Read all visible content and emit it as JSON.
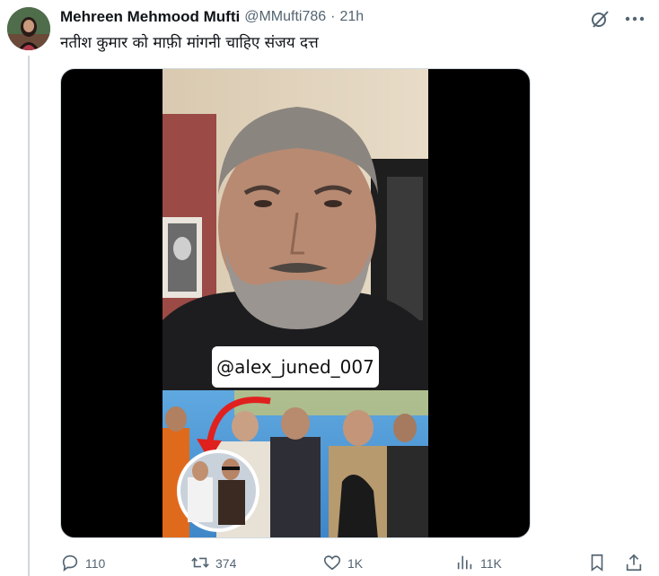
{
  "tweet": {
    "author_name": "Mehreen Mehmood Mufti",
    "handle": "@MMufti786",
    "separator": "·",
    "time": "21h",
    "text": "नतीश कुमार को माफ़ी मांगनी चाहिए संजय दत्त"
  },
  "media": {
    "overlay_tag": "@alex_juned_007"
  },
  "actions": {
    "replies": "110",
    "reposts": "374",
    "likes": "1K",
    "views": "11K"
  },
  "colors": {
    "text_primary": "#0f1419",
    "text_secondary": "#536471",
    "thread_line": "#cfd9de"
  }
}
